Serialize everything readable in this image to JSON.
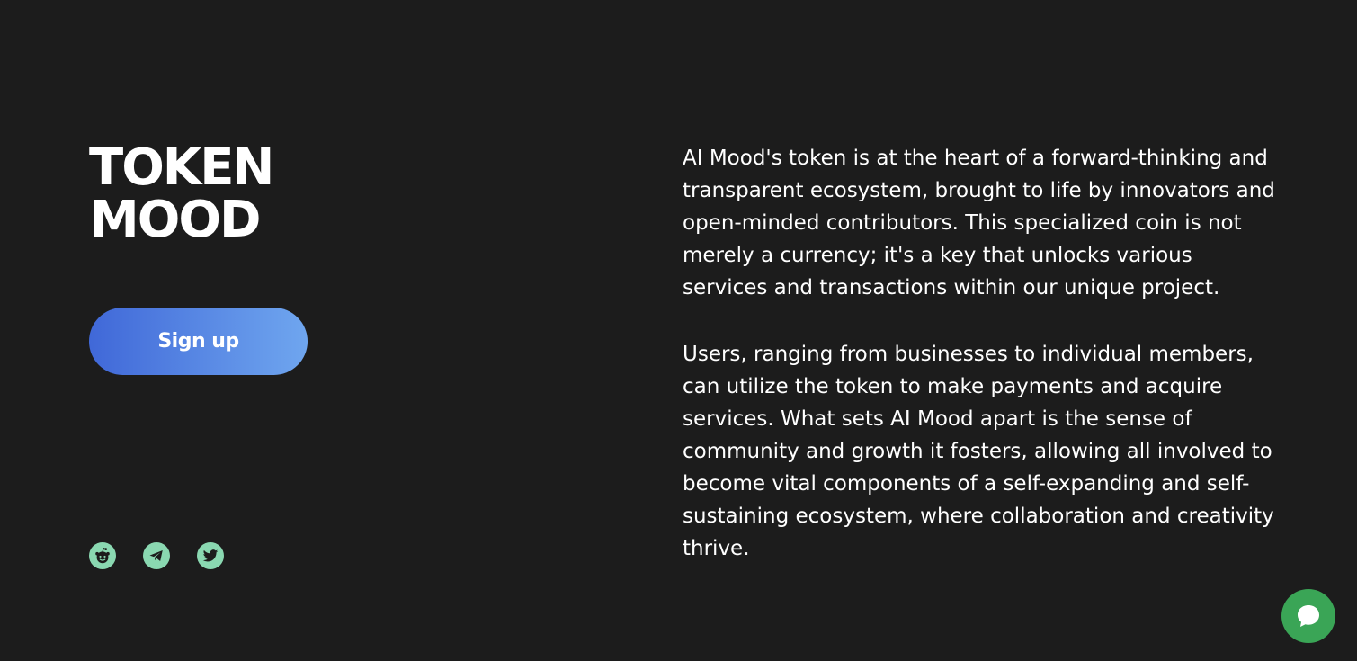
{
  "hero": {
    "title_line1": "TOKEN",
    "title_line2": "MOOD",
    "signup_label": "Sign up"
  },
  "socials": [
    {
      "icon": "reddit-icon"
    },
    {
      "icon": "telegram-icon"
    },
    {
      "icon": "twitter-icon"
    }
  ],
  "description": {
    "paragraph1": "AI Mood's token is at the heart of a forward-thinking and transparent ecosystem, brought to life by innovators and open-minded contributors. This specialized coin is not merely a currency; it's a key that unlocks various services and transactions within our unique project.",
    "paragraph2": "Users, ranging from businesses to individual members, can utilize the token to make payments and acquire services. What sets AI Mood apart is the sense of community and growth it fosters, allowing all involved to become vital components of a self-expanding and self-sustaining ecosystem, where collaboration and creativity thrive."
  },
  "chat": {
    "icon": "chat-bubble-icon"
  },
  "colors": {
    "background": "#1c1c1c",
    "button_gradient_start": "#4068d8",
    "button_gradient_end": "#6fa6ef",
    "social_bg": "#8ad8b1",
    "chat_bg": "#3aa556"
  }
}
